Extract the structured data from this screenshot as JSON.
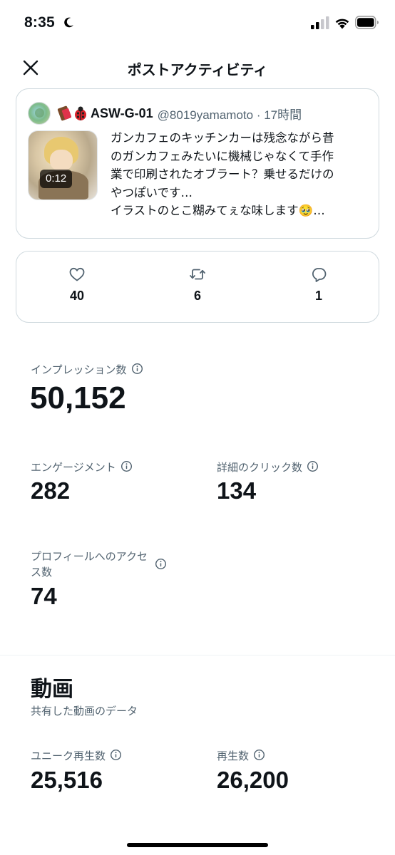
{
  "status_bar": {
    "time": "8:35",
    "icons": [
      "moon-icon",
      "signal-icon",
      "wifi-icon",
      "battery-icon"
    ]
  },
  "nav": {
    "title": "ポストアクティビティ",
    "close_icon": "close-icon"
  },
  "post": {
    "author_name": "ASW-G-01",
    "handle_time": "@8019yamamoto · 17時間",
    "emoji": [
      "chocolate-emoji",
      "ladybug-emoji"
    ],
    "video_duration": "0:12",
    "text_lines": [
      "ガンカフェのキッチンカーは残念ながら昔",
      "のガンカフェみたいに機械じゃなくて手作",
      "業で印刷されたオブラート？乗せるだけの",
      "やつぽいです…",
      "イラストのとこ糊みてぇな味します🥹…"
    ]
  },
  "engagement": {
    "likes": "40",
    "reposts": "6",
    "replies": "1"
  },
  "metrics": {
    "impressions": {
      "label": "インプレッション数",
      "value": "50,152"
    },
    "engagements": {
      "label": "エンゲージメント",
      "value": "282"
    },
    "detail_clicks": {
      "label": "詳細のクリック数",
      "value": "134"
    },
    "profile_visits": {
      "label_line1": "プロフィールへのアクセ",
      "label_line2": "ス数",
      "value": "74"
    }
  },
  "video_section": {
    "title": "動画",
    "subtitle": "共有した動画のデータ",
    "unique_plays": {
      "label": "ユニーク再生数",
      "value": "25,516"
    },
    "plays": {
      "label": "再生数",
      "value": "26,200"
    }
  },
  "colors": {
    "text_primary": "#0f1419",
    "text_secondary": "#536471",
    "border": "#cfd9de"
  }
}
